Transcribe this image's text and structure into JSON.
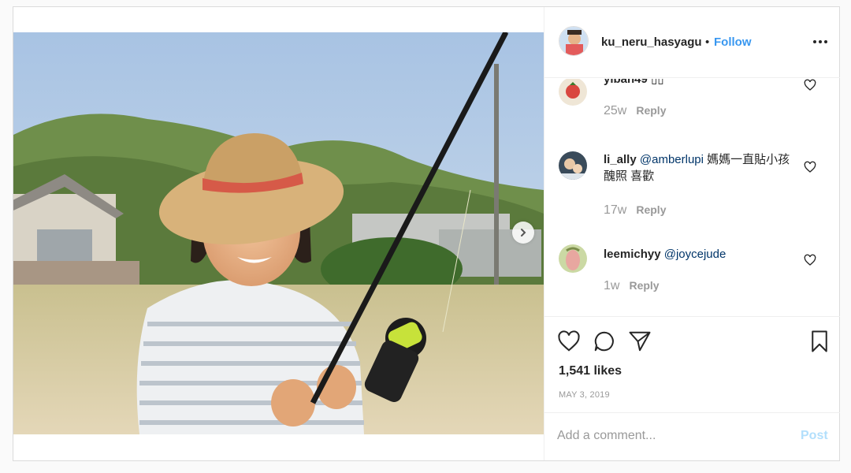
{
  "post": {
    "author": "ku_neru_hasyagu",
    "separator": "•",
    "follow_label": "Follow",
    "more_icon": "more-horizontal-icon",
    "photo_description_colors": {
      "sky": "#b9cfe6",
      "hill": "#6a8a46",
      "ground": "#dccba8"
    }
  },
  "comments": [
    {
      "user": "yiban49",
      "text": " ▯▯",
      "mention": "",
      "time": "25w",
      "reply_label": "Reply"
    },
    {
      "user": "li_ally",
      "mention": "@amberlupi",
      "text": " 媽媽一直貼小孩醜照 喜歡",
      "time": "17w",
      "reply_label": "Reply"
    },
    {
      "user": "leemichyy",
      "mention": "@joycejude",
      "text": "",
      "time": "1w",
      "reply_label": "Reply"
    }
  ],
  "actions": {
    "like_icon": "heart-icon",
    "comment_icon": "comment-bubble-icon",
    "share_icon": "paper-plane-icon",
    "save_icon": "bookmark-icon",
    "likes": "1,541 likes",
    "date": "MAY 3, 2019"
  },
  "add_comment": {
    "placeholder": "Add a comment...",
    "post_label": "Post"
  },
  "colors": {
    "link": "#3897f0",
    "mention": "#003569",
    "post_disabled": "#b2dffc",
    "muted": "#999999"
  }
}
